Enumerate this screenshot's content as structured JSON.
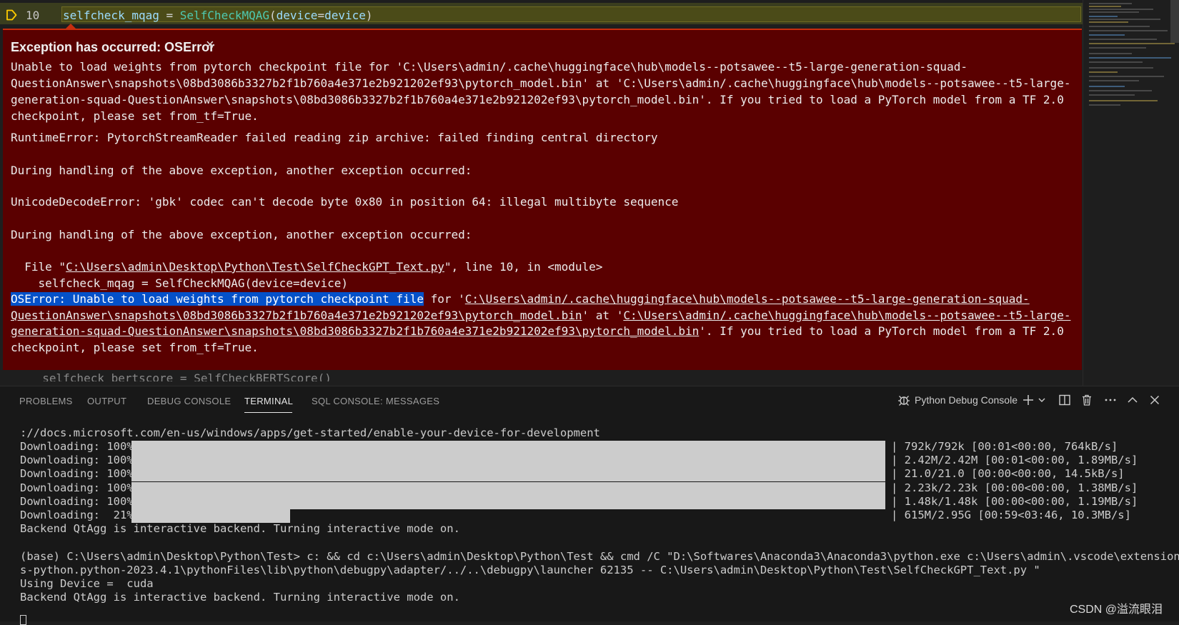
{
  "editor": {
    "line_number": "10",
    "code": {
      "var": "selfcheck_mqag",
      "eq": " = ",
      "cls": "SelfCheckMQAG",
      "open": "(",
      "arg": "device",
      "eq2": "=",
      "argval": "device",
      "close": ")"
    }
  },
  "exception": {
    "title": "Exception has occurred: OSError",
    "close_icon": "×",
    "lines": [
      "Unable to load weights from pytorch checkpoint file for 'C:\\Users\\admin/.cache\\huggingface\\hub\\models--potsawee--t5-large-generation-squad-",
      "QuestionAnswer\\snapshots\\08bd3086b3327b2f1b760a4e371e2b921202ef93\\pytorch_model.bin' at 'C:\\Users\\admin/.cache\\huggingface\\hub\\models--potsawee--t5-large-",
      "generation-squad-QuestionAnswer\\snapshots\\08bd3086b3327b2f1b760a4e371e2b921202ef93\\pytorch_model.bin'. If you tried to load a PyTorch model from a TF 2.0",
      "checkpoint, please set from_tf=True."
    ],
    "runtime_error": "RuntimeError: PytorchStreamReader failed reading zip archive: failed finding central directory",
    "during_1": "During handling of the above exception, another exception occurred:",
    "unicode_error": "UnicodeDecodeError: 'gbk' codec can't decode byte 0x80 in position 64: illegal multibyte sequence",
    "during_2": "During handling of the above exception, another exception occurred:",
    "file_prefix": "  File \"",
    "file_path": "C:\\Users\\admin\\Desktop\\Python\\Test\\SelfCheckGPT_Text.py",
    "file_suffix": "\", line 10, in <module>",
    "code_line": "    selfcheck_mqag = SelfCheckMQAG(device=device)",
    "os_selected": "OSError: Unable to load weights from pytorch checkpoint file",
    "os_for": " for '",
    "os_path1": "C:\\Users\\admin/.cache\\huggingface\\hub\\models--potsawee--t5-large-generation-squad-",
    "os_path2": "QuestionAnswer\\snapshots\\08bd3086b3327b2f1b760a4e371e2b921202ef93\\pytorch_model.bin",
    "os_at": "' at '",
    "os_path3": "C:\\Users\\admin/.cache\\huggingface\\hub\\models--potsawee--t5-large-",
    "os_path4": "generation-squad-QuestionAnswer\\snapshots\\08bd3086b3327b2f1b760a4e371e2b921202ef93\\pytorch_model.bin",
    "os_tail": "'. If you tried to load a PyTorch model from a TF 2.0",
    "os_last": "checkpoint, please set from_tf=True."
  },
  "ghost_code": "  selfcheck_bertscore = SelfCheckBERTScore()",
  "panel": {
    "tabs": [
      "PROBLEMS",
      "OUTPUT",
      "DEBUG CONSOLE",
      "TERMINAL",
      "SQL CONSOLE: MESSAGES"
    ],
    "active_tab": "TERMINAL",
    "terminal_name": "Python Debug Console",
    "icons": {
      "debug": "debug-icon",
      "add": "plus-icon",
      "dropdown": "chevron-down-icon",
      "split": "split-icon",
      "trash": "trash-icon",
      "more": "ellipsis-icon",
      "maximize": "chevron-up-icon",
      "close": "close-icon"
    }
  },
  "terminal": {
    "url_line": "://docs.microsoft.com/en-us/windows/apps/get-started/enable-your-device-for-development",
    "downloads": [
      {
        "label": "Downloading: 100%|",
        "progress": 1.0,
        "stats": "| 792k/792k [00:01<00:00, 764kB/s]"
      },
      {
        "label": "Downloading: 100%|",
        "progress": 1.0,
        "stats": "| 2.42M/2.42M [00:01<00:00, 1.89MB/s]"
      },
      {
        "label": "Downloading: 100%|",
        "progress": 1.0,
        "stats": "| 21.0/21.0 [00:00<00:00, 14.5kB/s]"
      },
      {
        "label": "Downloading: 100%|",
        "progress": 1.0,
        "stats": "| 2.23k/2.23k [00:00<00:00, 1.38MB/s]"
      },
      {
        "label": "Downloading: 100%|",
        "progress": 1.0,
        "stats": "| 1.48k/1.48k [00:00<00:00, 1.19MB/s]"
      },
      {
        "label": "Downloading:  21%|",
        "progress": 0.21,
        "stats": "| 615M/2.95G [00:59<03:46, 10.3MB/s]"
      }
    ],
    "backend_1": "Backend QtAgg is interactive backend. Turning interactive mode on.",
    "cmd_line_1": "(base) C:\\Users\\admin\\Desktop\\Python\\Test> c: && cd c:\\Users\\admin\\Desktop\\Python\\Test && cmd /C \"D:\\Softwares\\Anaconda3\\Anaconda3\\python.exe c:\\Users\\admin\\.vscode\\extensions\\m",
    "cmd_line_2": "s-python.python-2023.4.1\\pythonFiles\\lib\\python\\debugpy\\adapter/../..\\debugpy\\launcher 62135 -- C:\\Users\\admin\\Desktop\\Python\\Test\\SelfCheckGPT_Text.py \"",
    "device_line": "Using Device =  cuda",
    "backend_2": "Backend QtAgg is interactive backend. Turning interactive mode on."
  },
  "watermark": "CSDN @溢流眼泪"
}
